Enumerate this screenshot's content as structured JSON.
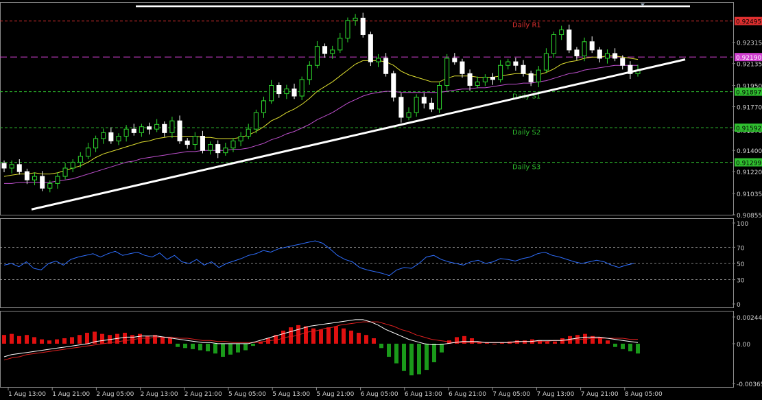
{
  "chart_data": [
    {
      "type": "candlestick",
      "pane": "price",
      "ylim": [
        0.90855,
        0.9265
      ],
      "y_ticks": [
        "0.92315",
        "0.92135",
        "0.91950",
        "0.91770",
        "0.91570",
        "0.91400",
        "0.91220",
        "0.91035",
        "0.90855"
      ],
      "levels": [
        {
          "label": "Daily R1",
          "value": 0.92495,
          "value_text": "0.92495",
          "color": "#e03030"
        },
        {
          "label": "",
          "value": 0.9219,
          "value_text": "0.92190",
          "color": "#d040d0"
        },
        {
          "label": "Daily S1",
          "value": 0.91897,
          "value_text": "0.91897",
          "color": "#2fbf2f"
        },
        {
          "label": "Daily S2",
          "value": 0.91592,
          "value_text": "0.91592",
          "color": "#2fbf2f"
        },
        {
          "label": "Daily S3",
          "value": 0.91299,
          "value_text": "0.91299",
          "color": "#2fbf2f"
        }
      ],
      "close_series": [
        0.9125,
        0.9128,
        0.9122,
        0.9115,
        0.9118,
        0.9108,
        0.9112,
        0.9118,
        0.9125,
        0.913,
        0.9135,
        0.9142,
        0.915,
        0.9155,
        0.9148,
        0.9152,
        0.9158,
        0.9155,
        0.916,
        0.9158,
        0.9162,
        0.9155,
        0.9165,
        0.9148,
        0.9145,
        0.9152,
        0.914,
        0.9145,
        0.9138,
        0.9142,
        0.9148,
        0.9152,
        0.9158,
        0.9172,
        0.9182,
        0.9195,
        0.9188,
        0.9192,
        0.9186,
        0.92,
        0.9212,
        0.9228,
        0.9222,
        0.9225,
        0.9235,
        0.925,
        0.9252,
        0.9238,
        0.9215,
        0.9218,
        0.9205,
        0.9185,
        0.9168,
        0.9172,
        0.9185,
        0.918,
        0.9175,
        0.9195,
        0.9218,
        0.9215,
        0.9205,
        0.9195,
        0.9198,
        0.9202,
        0.92,
        0.9212,
        0.9215,
        0.9212,
        0.9205,
        0.9198,
        0.9208,
        0.9222,
        0.9238,
        0.9242,
        0.9225,
        0.922,
        0.9232,
        0.9225,
        0.9218,
        0.9222,
        0.9218,
        0.9212,
        0.9205,
        0.9208
      ],
      "ma_yellow": [
        0.9118,
        0.9119,
        0.912,
        0.912,
        0.9121,
        0.912,
        0.912,
        0.9121,
        0.9123,
        0.9125,
        0.9127,
        0.913,
        0.9134,
        0.9137,
        0.9139,
        0.9141,
        0.9143,
        0.9145,
        0.9147,
        0.9148,
        0.915,
        0.9151,
        0.9152,
        0.9152,
        0.9152,
        0.9152,
        0.9151,
        0.9151,
        0.915,
        0.915,
        0.915,
        0.9151,
        0.9153,
        0.9156,
        0.916,
        0.9165,
        0.9168,
        0.9172,
        0.9175,
        0.9179,
        0.9184,
        0.919,
        0.9194,
        0.9198,
        0.9203,
        0.9208,
        0.9213,
        0.9216,
        0.9216,
        0.9216,
        0.9215,
        0.9212,
        0.9207,
        0.9204,
        0.9202,
        0.92,
        0.9198,
        0.9198,
        0.9201,
        0.9203,
        0.9203,
        0.9203,
        0.9202,
        0.9202,
        0.9202,
        0.9203,
        0.9204,
        0.9205,
        0.9205,
        0.9204,
        0.9204,
        0.9206,
        0.9209,
        0.9213,
        0.9215,
        0.9216,
        0.9218,
        0.9219,
        0.9219,
        0.922,
        0.922,
        0.9219,
        0.9218,
        0.9217
      ],
      "ma_purple": [
        0.9112,
        0.9112,
        0.9113,
        0.9113,
        0.9113,
        0.9113,
        0.9113,
        0.9114,
        0.9115,
        0.9116,
        0.9118,
        0.912,
        0.9122,
        0.9124,
        0.9126,
        0.9128,
        0.913,
        0.9131,
        0.9133,
        0.9134,
        0.9135,
        0.9136,
        0.9137,
        0.9138,
        0.9139,
        0.9139,
        0.914,
        0.914,
        0.914,
        0.914,
        0.9141,
        0.9141,
        0.9142,
        0.9144,
        0.9146,
        0.9149,
        0.9151,
        0.9154,
        0.9156,
        0.9159,
        0.9162,
        0.9166,
        0.9169,
        0.9172,
        0.9176,
        0.918,
        0.9183,
        0.9186,
        0.9188,
        0.9189,
        0.919,
        0.919,
        0.9189,
        0.9189,
        0.9189,
        0.9189,
        0.9189,
        0.9189,
        0.919,
        0.9191,
        0.9192,
        0.9192,
        0.9193,
        0.9193,
        0.9194,
        0.9195,
        0.9196,
        0.9196,
        0.9197,
        0.9197,
        0.9198,
        0.9199,
        0.9201,
        0.9203,
        0.9205,
        0.9206,
        0.9208,
        0.9209,
        0.921,
        0.9211,
        0.9212,
        0.9212,
        0.9212,
        0.9212
      ],
      "trendline": {
        "from": [
          0,
          0.909
        ],
        "to": [
          86,
          0.9217
        ],
        "color": "#ffffff"
      },
      "top_line": {
        "value": 0.9262,
        "color": "#ffffff"
      }
    },
    {
      "type": "line",
      "pane": "rsi",
      "ylim": [
        0,
        100
      ],
      "y_ticks": [
        "100",
        "70",
        "50",
        "30",
        "0"
      ],
      "levels": [
        70,
        50,
        30
      ],
      "values": [
        48,
        50,
        46,
        52,
        44,
        42,
        50,
        53,
        48,
        55,
        58,
        60,
        62,
        58,
        62,
        65,
        60,
        62,
        64,
        60,
        58,
        63,
        55,
        60,
        52,
        50,
        55,
        48,
        52,
        45,
        50,
        53,
        56,
        60,
        62,
        66,
        64,
        68,
        70,
        72,
        74,
        76,
        78,
        75,
        68,
        60,
        55,
        52,
        45,
        42,
        40,
        38,
        35,
        42,
        45,
        44,
        50,
        58,
        60,
        55,
        52,
        50,
        48,
        52,
        54,
        50,
        52,
        56,
        55,
        53,
        56,
        58,
        62,
        64,
        60,
        58,
        55,
        52,
        50,
        52,
        54,
        52,
        48,
        45,
        48,
        50
      ],
      "color": "#2f6fff"
    },
    {
      "type": "bar",
      "pane": "macd",
      "ylim": [
        -0.00365,
        0.002448
      ],
      "y_ticks": [
        "0.002448",
        "0.00",
        "-0.00365"
      ],
      "histogram": [
        0.0008,
        0.0009,
        0.0007,
        0.0008,
        0.0006,
        0.0004,
        0.0003,
        0.0004,
        0.0005,
        0.0006,
        0.0008,
        0.001,
        0.0011,
        0.0009,
        0.0008,
        0.0009,
        0.001,
        0.0008,
        0.0009,
        0.0007,
        0.0008,
        0.0006,
        0.0005,
        -0.0003,
        -0.0004,
        -0.0005,
        -0.0006,
        -0.0007,
        -0.0009,
        -0.0012,
        -0.001,
        -0.0008,
        -0.0006,
        -0.0002,
        0.0002,
        0.0005,
        0.0008,
        0.0012,
        0.0015,
        0.0017,
        0.0016,
        0.0014,
        0.0013,
        0.0015,
        0.0016,
        0.0014,
        0.0012,
        0.001,
        0.0008,
        0.0005,
        -0.0004,
        -0.0012,
        -0.0018,
        -0.0025,
        -0.0029,
        -0.0028,
        -0.0024,
        -0.0017,
        -0.0008,
        0.0003,
        0.0006,
        0.0007,
        0.0005,
        0.0002,
        0.0001,
        0.0,
        0.0001,
        0.0002,
        0.0003,
        0.0003,
        0.0004,
        0.0003,
        0.0002,
        0.0002,
        0.0005,
        0.0007,
        0.0008,
        0.0009,
        0.0007,
        0.0006,
        0.0003,
        -0.0003,
        -0.0005,
        -0.0007,
        -0.0009
      ],
      "macd_line": [
        -0.0012,
        -0.001,
        -0.0009,
        -0.0008,
        -0.0007,
        -0.0006,
        -0.0005,
        -0.0004,
        -0.0003,
        -0.0002,
        -0.0001,
        0.0,
        0.0002,
        0.0003,
        0.0004,
        0.0005,
        0.0006,
        0.0006,
        0.0007,
        0.0007,
        0.0007,
        0.0006,
        0.0005,
        0.0004,
        0.0003,
        0.0002,
        0.0001,
        0.0001,
        0.0,
        0.0,
        0.0,
        0.0,
        0.0,
        0.0002,
        0.0004,
        0.0006,
        0.0008,
        0.001,
        0.0012,
        0.0014,
        0.0016,
        0.0017,
        0.0018,
        0.0019,
        0.002,
        0.0021,
        0.0022,
        0.0022,
        0.002,
        0.0017,
        0.0013,
        0.001,
        0.0007,
        0.0004,
        0.0002,
        0.0,
        -0.0001,
        -0.0001,
        0.0,
        0.0001,
        0.0002,
        0.0002,
        0.0002,
        0.0001,
        0.0001,
        0.0001,
        0.0001,
        0.0002,
        0.0002,
        0.0002,
        0.0003,
        0.0003,
        0.0003,
        0.0003,
        0.0004,
        0.0005,
        0.0006,
        0.0006,
        0.0006,
        0.0005,
        0.0004,
        0.0003,
        0.0002,
        0.0001
      ],
      "signal_line": [
        -0.0015,
        -0.0013,
        -0.0012,
        -0.001,
        -0.0009,
        -0.0008,
        -0.0007,
        -0.0006,
        -0.0005,
        -0.0004,
        -0.0003,
        -0.0002,
        -0.0001,
        0.0,
        0.0001,
        0.0002,
        0.0003,
        0.0004,
        0.0005,
        0.0005,
        0.0006,
        0.0006,
        0.0006,
        0.0005,
        0.0005,
        0.0004,
        0.0003,
        0.0003,
        0.0002,
        0.0002,
        0.0001,
        0.0001,
        0.0001,
        0.0001,
        0.0002,
        0.0003,
        0.0004,
        0.0006,
        0.0007,
        0.0009,
        0.0011,
        0.0012,
        0.0014,
        0.0015,
        0.0017,
        0.0018,
        0.0019,
        0.002,
        0.002,
        0.002,
        0.0018,
        0.0016,
        0.0013,
        0.0011,
        0.0008,
        0.0006,
        0.0004,
        0.0003,
        0.0002,
        0.0001,
        0.0001,
        0.0001,
        0.0001,
        0.0001,
        0.0001,
        0.0001,
        0.0001,
        0.0001,
        0.0002,
        0.0002,
        0.0002,
        0.0002,
        0.0003,
        0.0003,
        0.0003,
        0.0004,
        0.0004,
        0.0005,
        0.0005,
        0.0005,
        0.0005,
        0.0005,
        0.0004,
        0.0004
      ]
    }
  ],
  "x_labels": [
    "1 Aug 13:00",
    "1 Aug 21:00",
    "2 Aug 05:00",
    "2 Aug 13:00",
    "2 Aug 21:00",
    "5 Aug 05:00",
    "5 Aug 13:00",
    "5 Aug 21:00",
    "6 Aug 05:00",
    "6 Aug 13:00",
    "6 Aug 21:00",
    "7 Aug 05:00",
    "7 Aug 13:00",
    "7 Aug 21:00",
    "8 Aug 05:00"
  ],
  "colors": {
    "bull": "#2fdc2f",
    "bear": "#ffffff",
    "ma_yellow": "#e0e030",
    "ma_purple": "#c050d0",
    "hist_pos": "#e01010",
    "hist_neg": "#1a9a1a",
    "macd": "#ffffff",
    "signal": "#e02020",
    "grid": "#b0b0b0",
    "label": "#d0d0d0"
  }
}
